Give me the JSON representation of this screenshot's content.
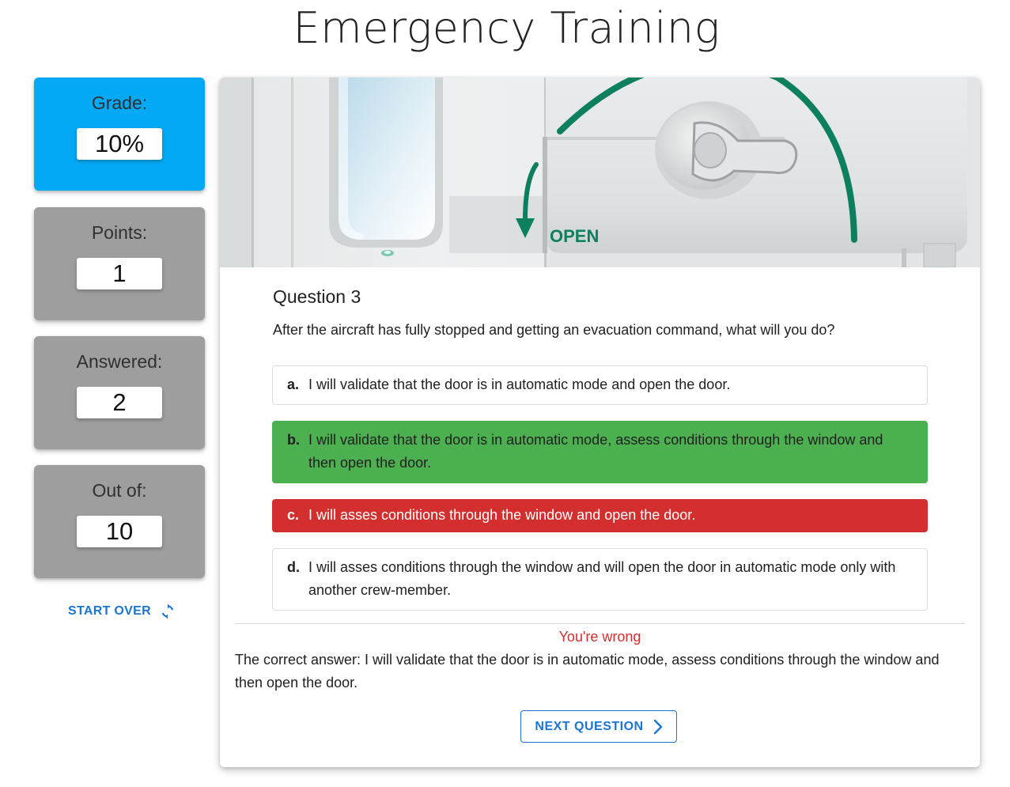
{
  "header": {
    "title": "Emergency Training"
  },
  "stats": [
    {
      "label": "Grade:",
      "value": "10%"
    },
    {
      "label": "Points:",
      "value": "1"
    },
    {
      "label": "Answered:",
      "value": "2"
    },
    {
      "label": "Out of:",
      "value": "10"
    }
  ],
  "start_over": {
    "label": "START OVER",
    "icon": "refresh-icon"
  },
  "hero": {
    "door_label": "OPEN"
  },
  "question": {
    "number": "Question 3",
    "text": "After the aircraft has fully stopped and getting an evacuation command, what will you do?",
    "answers": [
      {
        "letter": "a.",
        "text": "I will validate that the door is in automatic mode and open the door.",
        "state": "neutral"
      },
      {
        "letter": "b.",
        "text": "I will validate that the door is in automatic mode, assess conditions through the window and then open the door.",
        "state": "correct"
      },
      {
        "letter": "c.",
        "text": "I will asses conditions through the window and open the door.",
        "state": "wrong"
      },
      {
        "letter": "d.",
        "text": "I will asses conditions through the window and will open the door in automatic mode only with another crew-member.",
        "state": "neutral"
      }
    ]
  },
  "feedback": {
    "result": "You're wrong",
    "correct_answer": "The correct answer: I will validate that the door is in automatic mode, assess conditions through the window and then open the door."
  },
  "next_button": {
    "label": "NEXT QUESTION",
    "icon": "chevron-right-icon"
  },
  "colors": {
    "accent": "#1976d2",
    "grade_card": "#03a9f4",
    "stat_card": "#9e9e9e",
    "correct": "#4caf50",
    "wrong": "#d32f2f",
    "arrow_green": "#0b7f5e"
  }
}
